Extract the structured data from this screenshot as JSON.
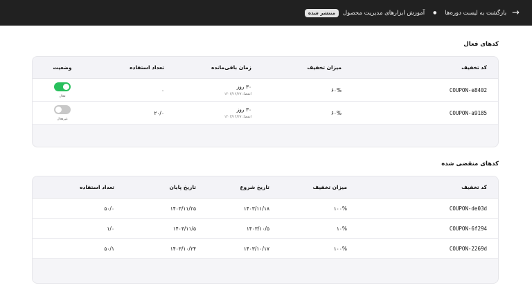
{
  "header": {
    "back_label": "بازگشت به لیست دوره‌ها",
    "course_title": "آموزش ابزارهای مدیریت محصول",
    "status_badge": "منتشر شده"
  },
  "active": {
    "title": "کدهای فعال",
    "columns": [
      "کد تخفیف",
      "میزان تخفیف",
      "زمان باقی‌مانده",
      "تعداد استفاده",
      "وضعیت"
    ],
    "rows": [
      {
        "code": "COUPON-e8402",
        "discount": "۶۰%",
        "remaining": "۳۰ روز",
        "expiry": "انقضا: ۱۴۰۳/۱۲/۲۷",
        "usage": "۰",
        "enabled": true,
        "status_label": "فعال"
      },
      {
        "code": "COUPON-a9185",
        "discount": "۶۰%",
        "remaining": "۳۰ روز",
        "expiry": "انقضا: ۱۴۰۳/۱۲/۲۷",
        "usage": "۲۰/۰",
        "enabled": false,
        "status_label": "غیرفعال"
      }
    ]
  },
  "expired": {
    "title": "کدهای منقضی شده",
    "columns": [
      "کد تخفیف",
      "میزان تخفیف",
      "تاریخ شروع",
      "تاریخ پایان",
      "تعداد استفاده"
    ],
    "rows": [
      {
        "code": "COUPON-de03d",
        "discount": "۱۰۰%",
        "start": "۱۴۰۳/۱۱/۱۸",
        "end": "۱۴۰۳/۱۱/۲۵",
        "usage": "۵۰/۰"
      },
      {
        "code": "COUPON-6f294",
        "discount": "۱۰%",
        "start": "۱۴۰۳/۱۰/۵",
        "end": "۱۴۰۳/۱۱/۵",
        "usage": "۱/۰"
      },
      {
        "code": "COUPON-2269d",
        "discount": "۱۰۰%",
        "start": "۱۴۰۳/۱۰/۱۷",
        "end": "۱۴۰۳/۱۰/۲۴",
        "usage": "۵۰/۱"
      }
    ]
  }
}
